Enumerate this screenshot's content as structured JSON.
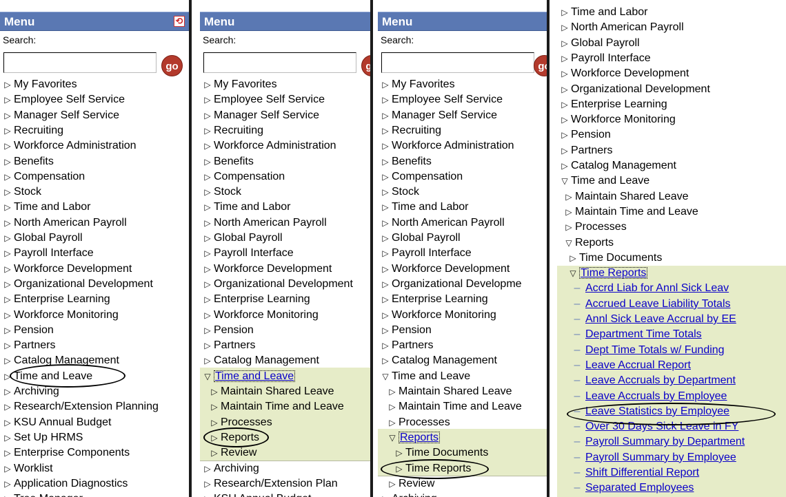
{
  "common": {
    "menu_title": "Menu",
    "search_label": "Search:",
    "go_label": "go"
  },
  "panel1": [
    {
      "label": "My Favorites",
      "t": "c"
    },
    {
      "label": "Employee Self Service",
      "t": "c"
    },
    {
      "label": "Manager Self Service",
      "t": "c"
    },
    {
      "label": "Recruiting",
      "t": "c"
    },
    {
      "label": "Workforce Administration",
      "t": "c"
    },
    {
      "label": "Benefits",
      "t": "c"
    },
    {
      "label": "Compensation",
      "t": "c"
    },
    {
      "label": "Stock",
      "t": "c"
    },
    {
      "label": "Time and Labor",
      "t": "c"
    },
    {
      "label": "North American Payroll",
      "t": "c"
    },
    {
      "label": "Global Payroll",
      "t": "c"
    },
    {
      "label": "Payroll Interface",
      "t": "c"
    },
    {
      "label": "Workforce Development",
      "t": "c"
    },
    {
      "label": "Organizational Development",
      "t": "c"
    },
    {
      "label": "Enterprise Learning",
      "t": "c"
    },
    {
      "label": "Workforce Monitoring",
      "t": "c"
    },
    {
      "label": "Pension",
      "t": "c"
    },
    {
      "label": "Partners",
      "t": "c"
    },
    {
      "label": "Catalog Management",
      "t": "c"
    },
    {
      "label": "Time and Leave",
      "t": "c"
    },
    {
      "label": "Archiving",
      "t": "c"
    },
    {
      "label": "Research/Extension Planning",
      "t": "c"
    },
    {
      "label": "KSU Annual Budget",
      "t": "c"
    },
    {
      "label": "Set Up HRMS",
      "t": "c"
    },
    {
      "label": "Enterprise Components",
      "t": "c"
    },
    {
      "label": "Worklist",
      "t": "c"
    },
    {
      "label": "Application Diagnostics",
      "t": "c"
    },
    {
      "label": "Tree Manager",
      "t": "c"
    }
  ],
  "panel2": [
    {
      "label": "My Favorites",
      "t": "c"
    },
    {
      "label": "Employee Self Service",
      "t": "c"
    },
    {
      "label": "Manager Self Service",
      "t": "c"
    },
    {
      "label": "Recruiting",
      "t": "c"
    },
    {
      "label": "Workforce Administration",
      "t": "c"
    },
    {
      "label": "Benefits",
      "t": "c"
    },
    {
      "label": "Compensation",
      "t": "c"
    },
    {
      "label": "Stock",
      "t": "c"
    },
    {
      "label": "Time and Labor",
      "t": "c"
    },
    {
      "label": "North American Payroll",
      "t": "c"
    },
    {
      "label": "Global Payroll",
      "t": "c"
    },
    {
      "label": "Payroll Interface",
      "t": "c"
    },
    {
      "label": "Workforce Development",
      "t": "c"
    },
    {
      "label": "Organizational Development",
      "t": "c"
    },
    {
      "label": "Enterprise Learning",
      "t": "c"
    },
    {
      "label": "Workforce Monitoring",
      "t": "c"
    },
    {
      "label": "Pension",
      "t": "c"
    },
    {
      "label": "Partners",
      "t": "c"
    },
    {
      "label": "Catalog Management",
      "t": "c"
    },
    {
      "label": "Time and Leave",
      "t": "o",
      "link": true,
      "sel": true
    },
    {
      "label": "Maintain Shared Leave",
      "t": "c",
      "ind": 1
    },
    {
      "label": "Maintain Time and Leave",
      "t": "c",
      "ind": 1
    },
    {
      "label": "Processes",
      "t": "c",
      "ind": 1
    },
    {
      "label": "Reports",
      "t": "c",
      "ind": 1
    },
    {
      "label": "Review",
      "t": "c",
      "ind": 1
    },
    {
      "label": "Archiving",
      "t": "c"
    },
    {
      "label": "Research/Extension Plan",
      "t": "c"
    },
    {
      "label": "KSU Annual Budget",
      "t": "c"
    }
  ],
  "panel3": [
    {
      "label": "My Favorites",
      "t": "c"
    },
    {
      "label": "Employee Self Service",
      "t": "c"
    },
    {
      "label": "Manager Self Service",
      "t": "c"
    },
    {
      "label": "Recruiting",
      "t": "c"
    },
    {
      "label": "Workforce Administration",
      "t": "c"
    },
    {
      "label": "Benefits",
      "t": "c"
    },
    {
      "label": "Compensation",
      "t": "c"
    },
    {
      "label": "Stock",
      "t": "c"
    },
    {
      "label": "Time and Labor",
      "t": "c"
    },
    {
      "label": "North American Payroll",
      "t": "c"
    },
    {
      "label": "Global Payroll",
      "t": "c"
    },
    {
      "label": "Payroll Interface",
      "t": "c"
    },
    {
      "label": "Workforce Development",
      "t": "c"
    },
    {
      "label": "Organizational Developme",
      "t": "c"
    },
    {
      "label": "Enterprise Learning",
      "t": "c"
    },
    {
      "label": "Workforce Monitoring",
      "t": "c"
    },
    {
      "label": "Pension",
      "t": "c"
    },
    {
      "label": "Partners",
      "t": "c"
    },
    {
      "label": "Catalog Management",
      "t": "c"
    },
    {
      "label": "Time and Leave",
      "t": "o"
    },
    {
      "label": "Maintain Shared Leave",
      "t": "c",
      "ind": 1
    },
    {
      "label": "Maintain Time and Leave",
      "t": "c",
      "ind": 1
    },
    {
      "label": "Processes",
      "t": "c",
      "ind": 1
    },
    {
      "label": "Reports",
      "t": "o",
      "ind": 1,
      "link": true,
      "sel": true
    },
    {
      "label": "Time Documents",
      "t": "c",
      "ind": 2
    },
    {
      "label": "Time Reports",
      "t": "c",
      "ind": 2
    },
    {
      "label": "Review",
      "t": "c",
      "ind": 1
    },
    {
      "label": "Archiving",
      "t": "c"
    }
  ],
  "panel4": [
    {
      "label": "Time and Labor",
      "t": "c"
    },
    {
      "label": "North American Payroll",
      "t": "c"
    },
    {
      "label": "Global Payroll",
      "t": "c"
    },
    {
      "label": "Payroll Interface",
      "t": "c"
    },
    {
      "label": "Workforce Development",
      "t": "c"
    },
    {
      "label": "Organizational Development",
      "t": "c"
    },
    {
      "label": "Enterprise Learning",
      "t": "c"
    },
    {
      "label": "Workforce Monitoring",
      "t": "c"
    },
    {
      "label": "Pension",
      "t": "c"
    },
    {
      "label": "Partners",
      "t": "c"
    },
    {
      "label": "Catalog Management",
      "t": "c"
    },
    {
      "label": "Time and Leave",
      "t": "o"
    },
    {
      "label": "Maintain Shared Leave",
      "t": "c",
      "ind": 1
    },
    {
      "label": "Maintain Time and Leave",
      "t": "c",
      "ind": 1
    },
    {
      "label": "Processes",
      "t": "c",
      "ind": 1
    },
    {
      "label": "Reports",
      "t": "o",
      "ind": 1
    },
    {
      "label": "Time Documents",
      "t": "c",
      "ind": 2
    },
    {
      "label": "Time Reports",
      "t": "o",
      "ind": 2,
      "link": true,
      "sel": true
    },
    {
      "label": "Accrd Liab for Annl Sick Leav",
      "t": "d",
      "ind": 3,
      "link": true
    },
    {
      "label": "Accrued Leave Liability Totals",
      "t": "d",
      "ind": 3,
      "link": true
    },
    {
      "label": "Annl Sick Leave Accrual by EE",
      "t": "d",
      "ind": 3,
      "link": true
    },
    {
      "label": "Department Time Totals",
      "t": "d",
      "ind": 3,
      "link": true
    },
    {
      "label": "Dept Time Totals w/ Funding",
      "t": "d",
      "ind": 3,
      "link": true
    },
    {
      "label": "Leave Accrual Report",
      "t": "d",
      "ind": 3,
      "link": true
    },
    {
      "label": "Leave Accruals by Department",
      "t": "d",
      "ind": 3,
      "link": true
    },
    {
      "label": "Leave Accruals by Employee",
      "t": "d",
      "ind": 3,
      "link": true
    },
    {
      "label": "Leave Statistics by Employee",
      "t": "d",
      "ind": 3,
      "link": true
    },
    {
      "label": "Over 30 Days Sick Leave in FY",
      "t": "d",
      "ind": 3,
      "link": true
    },
    {
      "label": "Payroll Summary by Department",
      "t": "d",
      "ind": 3,
      "link": true
    },
    {
      "label": "Payroll Summary by Employee",
      "t": "d",
      "ind": 3,
      "link": true
    },
    {
      "label": "Shift Differential Report",
      "t": "d",
      "ind": 3,
      "link": true
    },
    {
      "label": "Separated Employees",
      "t": "d",
      "ind": 3,
      "link": true
    }
  ]
}
